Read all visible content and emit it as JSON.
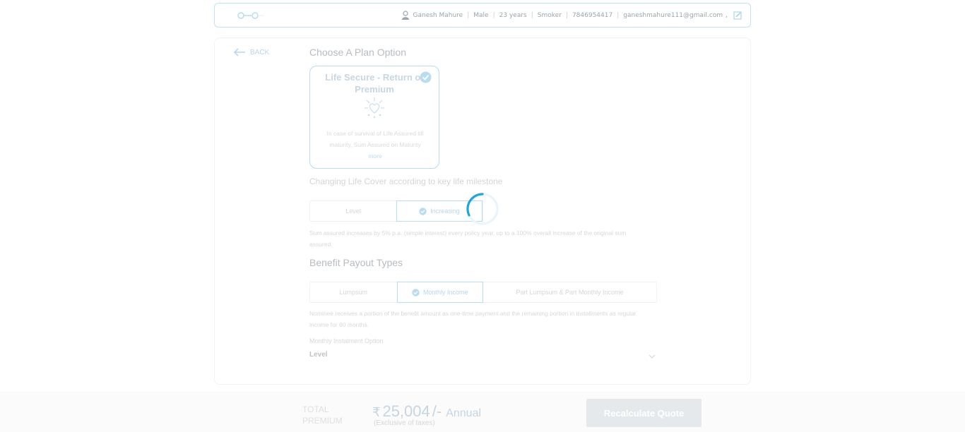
{
  "header": {
    "user_name": "Ganesh Mahure",
    "gender": "Male",
    "age": "23 years",
    "smoker": "Smoker",
    "phone": "7846954417",
    "email": "ganeshmahure111@gmail.com",
    "comma": ","
  },
  "nav": {
    "back_label": "BACK"
  },
  "plan_section": {
    "title": "Choose A Plan Option",
    "plan": {
      "name": "Life Secure - Return of Premium",
      "description": "In case of survival of Life Assured till maturity, Sum Assured on Maturity",
      "more_label": "more"
    }
  },
  "cover_section": {
    "title": "Changing Life Cover according to key life milestone",
    "options": [
      "Level",
      "Increasing"
    ],
    "selected": "Increasing",
    "note": "Sum assured increases by 5% p.a. (simple interest) every policy year, up to a 100% overall increase of the original sum assured."
  },
  "payout_section": {
    "title": "Benefit Payout Types",
    "options": [
      "Lumpsum",
      "Monthly Income",
      "Part Lumpsum & Part Monthly Income"
    ],
    "selected": "Monthly Income",
    "note": "Nominee receives a portion of the benefit amount as one-time payment and the remaining portion in installments as regular income for 60 months.",
    "installment_label": "Monthly Instalment Option",
    "installment_value": "Level"
  },
  "footer": {
    "total_label_line1": "TOTAL",
    "total_label_line2": "PREMIUM",
    "currency_symbol": "₹",
    "amount": "25,004",
    "suffix": "/-",
    "frequency": "Annual",
    "tax_note": "(Exclusive of taxes)",
    "recalculate_label": "Recalculate Quote"
  },
  "colors": {
    "accent": "#1ea5e0",
    "border_light": "#b8dcf0"
  }
}
